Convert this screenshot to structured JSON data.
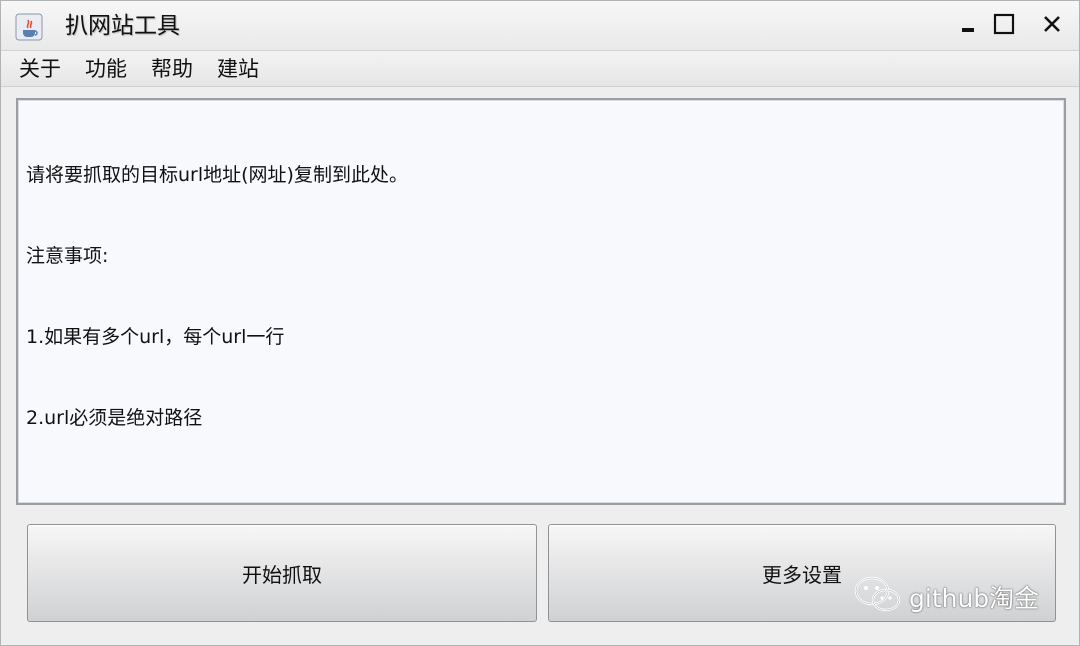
{
  "window": {
    "title": "扒网站工具",
    "icon": "java-cup-icon"
  },
  "menu": {
    "items": [
      {
        "label": "关于"
      },
      {
        "label": "功能"
      },
      {
        "label": "帮助"
      },
      {
        "label": "建站"
      }
    ]
  },
  "textarea": {
    "lines": [
      "请将要抓取的目标url地址(网址)复制到此处。",
      "注意事项:",
      "1.如果有多个url，每个url一行",
      "2.url必须是绝对路径"
    ]
  },
  "buttons": {
    "start_label": "开始抓取",
    "more_label": "更多设置"
  },
  "watermark": {
    "text": "github淘金",
    "icon": "wechat-icon"
  },
  "colors": {
    "textarea_bg": "#f8f9fd",
    "window_bg": "#eeeeee"
  }
}
